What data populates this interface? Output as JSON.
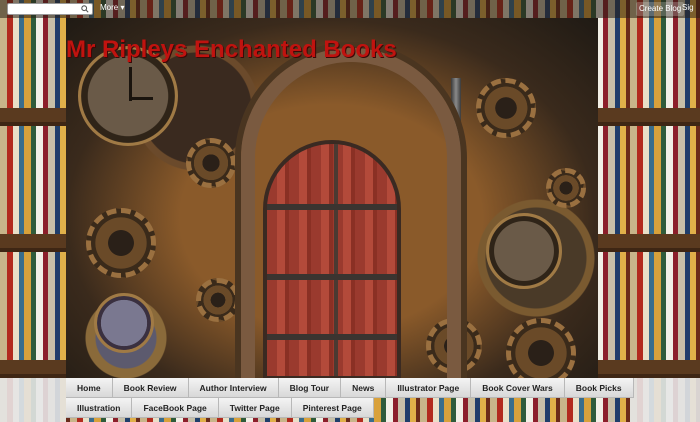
{
  "navbar": {
    "search_placeholder": "",
    "more_label": "More",
    "create_blog_label": "Create Blog",
    "sign_in_label": "Sig"
  },
  "header": {
    "title": "Mr Ripleys Enchanted Books"
  },
  "tabs_row1": [
    {
      "label": "Home"
    },
    {
      "label": "Book Review"
    },
    {
      "label": "Author Interview"
    },
    {
      "label": "Blog Tour"
    },
    {
      "label": "News"
    },
    {
      "label": "Illustrator Page"
    },
    {
      "label": "Book Cover Wars"
    },
    {
      "label": "Book Picks"
    }
  ],
  "tabs_row2": [
    {
      "label": "Illustration"
    },
    {
      "label": "FaceBook Page"
    },
    {
      "label": "Twitter Page"
    },
    {
      "label": "Pinterest Page"
    }
  ],
  "colors": {
    "title": "#c0130f",
    "tab_bg": "#e6e6e6"
  }
}
